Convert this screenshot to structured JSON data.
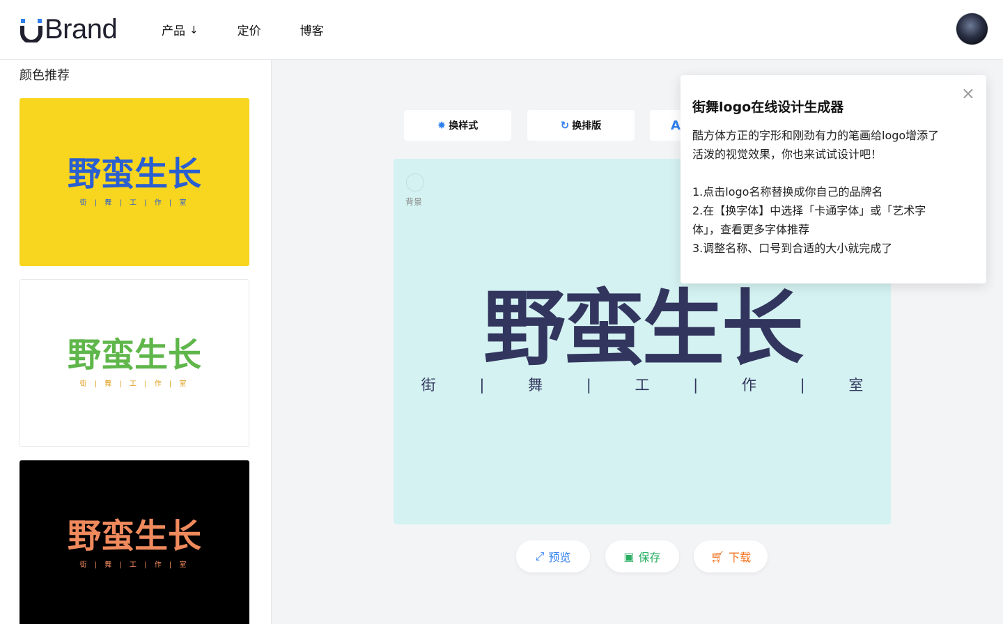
{
  "header": {
    "logo_text": "Brand",
    "nav": [
      {
        "label": "产品",
        "arrow": "↓"
      },
      {
        "label": "定价"
      },
      {
        "label": "博客"
      }
    ]
  },
  "sidebar": {
    "title": "颜色推荐",
    "swatches": [
      {
        "logo": "野蛮生长",
        "sub": "街 | 舞 | 工 | 作 | 室",
        "bg": "#f8d51e",
        "main_color": "#2a5fd1",
        "sub_color": "#2a5fd1"
      },
      {
        "logo": "野蛮生长",
        "sub": "街 | 舞 | 工 | 作 | 室",
        "bg": "#ffffff",
        "main_color": "#5fb64a",
        "sub_color": "#e0a020"
      },
      {
        "logo": "野蛮生长",
        "sub": "街 | 舞 | 工 | 作 | 室",
        "bg": "#000000",
        "main_color": "#f08a5d",
        "sub_color": "#f08a5d"
      }
    ]
  },
  "toolbar": {
    "style_label": "换样式",
    "layout_label": "换排版",
    "font_icon_letter": "A"
  },
  "canvas": {
    "bg_label": "背景",
    "logo": "野蛮生长",
    "sub": "街 | 舞 | 工 | 作 | 室",
    "bg_color": "#d4f2f1",
    "text_color": "#32365e"
  },
  "actions": {
    "preview_label": "预览",
    "save_label": "保存",
    "download_label": "下载"
  },
  "popup": {
    "close": "×",
    "title": "街舞logo在线设计生成器",
    "intro_1": "酷方体方正的字形和刚劲有力的笔画给logo增添了",
    "intro_2": "活泼的视觉效果，你也来试试设计吧！",
    "step_1": "1.点击logo名称替换成你自己的品牌名",
    "step_2a": "2.在【换字体】中选择「卡通字体」或「艺术字",
    "step_2b": "体」，查看更多字体推荐",
    "step_3": "3.调整名称、口号到合适的大小就完成了"
  }
}
